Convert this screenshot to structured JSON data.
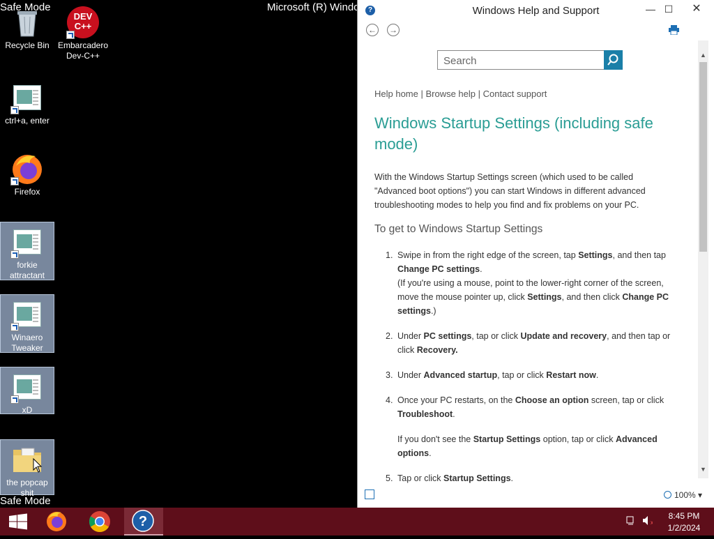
{
  "desktop": {
    "safe_mode_label": "Safe Mode",
    "build_text": "Microsoft (R) Windo",
    "icons": [
      {
        "label": "Recycle Bin"
      },
      {
        "label": "Embarcadero Dev-C++"
      },
      {
        "label": "ctrl+a, enter"
      },
      {
        "label": "Firefox"
      },
      {
        "label": "forkie attractant"
      },
      {
        "label": "Winaero Tweaker"
      },
      {
        "label": "xD"
      },
      {
        "label": "the popcap shit"
      }
    ],
    "devcpp_badge": "DEV C++"
  },
  "help_window": {
    "title": "Windows Help and Support",
    "search_placeholder": "Search",
    "links": "Help home | Browse help | Contact support",
    "heading": "Windows Startup Settings (including safe mode)",
    "intro": "With the Windows Startup Settings screen (which used to be called \"Advanced boot options\") you can start Windows in different advanced troubleshooting modes to help you find and fix problems on your PC.",
    "subheading": "To get to Windows Startup Settings",
    "steps": [
      {
        "n": "1.",
        "t1": "Swipe in from the right edge of the screen, tap ",
        "b1": "Settings",
        "t2": ", and then tap ",
        "b2": "Change PC settings",
        "t3": ".",
        "s1": "(If you're using a mouse, point to the lower-right corner of the screen, move the mouse pointer up, click ",
        "sb1": "Settings",
        "s2": ", and then click ",
        "sb2": "Change PC settings",
        "s3": ".)"
      },
      {
        "n": "2.",
        "t1": "Under ",
        "b1": "PC settings",
        "t2": ", tap or click ",
        "b2": "Update and recovery",
        "t3": ", and then tap or click ",
        "b3": "Recovery."
      },
      {
        "n": "3.",
        "t1": "Under ",
        "b1": "Advanced startup",
        "t2": ", tap or click ",
        "b2": "Restart now",
        "t3": "."
      },
      {
        "n": "4.",
        "t1": "Once your PC restarts, on the ",
        "b1": "Choose an option",
        "t2": " screen, tap or click ",
        "b2": "Troubleshoot",
        "t3": ".",
        "s1": "If you don't see the ",
        "sb1": "Startup Settings",
        "s2": " option, tap or click ",
        "sb2": "Advanced options",
        "s3": "."
      },
      {
        "n": "5.",
        "t1": "Tap or click ",
        "b1": "Startup Settings",
        "t2": "."
      }
    ],
    "zoom": "100%"
  },
  "taskbar": {
    "time": "8:45 PM",
    "date": "1/2/2024"
  },
  "colors": {
    "taskbar": "#5e0e1a",
    "heading": "#2a9d94",
    "search_button": "#1a7fa8"
  }
}
